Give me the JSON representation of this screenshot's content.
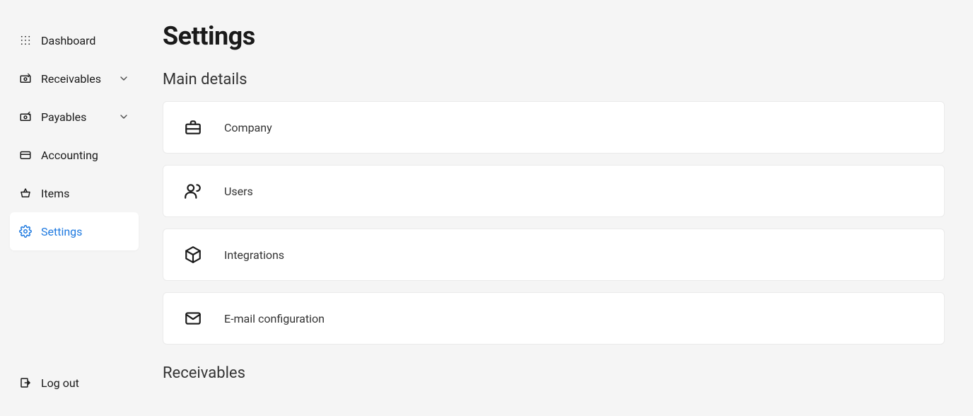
{
  "sidebar": {
    "items": [
      {
        "label": "Dashboard"
      },
      {
        "label": "Receivables"
      },
      {
        "label": "Payables"
      },
      {
        "label": "Accounting"
      },
      {
        "label": "Items"
      },
      {
        "label": "Settings"
      }
    ],
    "logout_label": "Log out"
  },
  "page": {
    "title": "Settings"
  },
  "sections": {
    "main_details": {
      "title": "Main details",
      "cards": [
        {
          "label": "Company"
        },
        {
          "label": "Users"
        },
        {
          "label": "Integrations"
        },
        {
          "label": "E-mail configuration"
        }
      ]
    },
    "receivables": {
      "title": "Receivables"
    }
  }
}
